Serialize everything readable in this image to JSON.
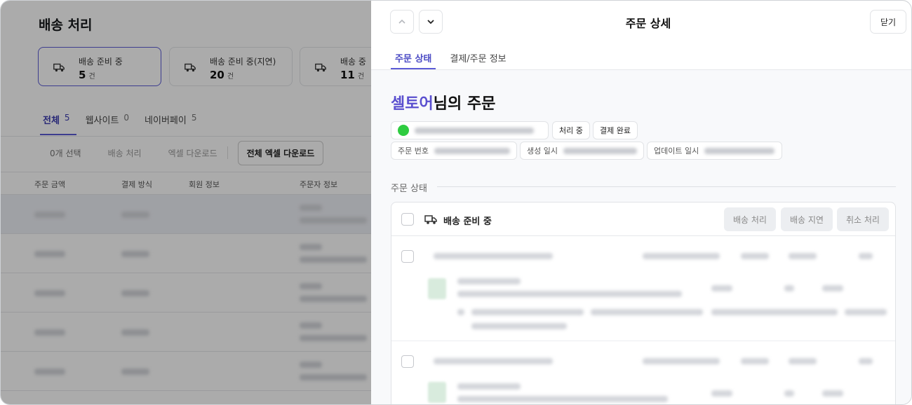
{
  "background": {
    "title": "배송 처리",
    "stats": [
      {
        "label": "배송 준비 중",
        "count": "5",
        "unit": "건"
      },
      {
        "label": "배송 준비 중(지연)",
        "count": "20",
        "unit": "건"
      },
      {
        "label": "배송 중",
        "count": "11",
        "unit": "건"
      }
    ],
    "tabs": [
      {
        "label": "전체",
        "count": "5"
      },
      {
        "label": "웹사이트",
        "count": "0"
      },
      {
        "label": "네이버페이",
        "count": "5"
      }
    ],
    "actions": {
      "selected": "0개 선택",
      "ship": "배송 처리",
      "excel": "엑셀 다운로드",
      "excel_all": "전체 엑셀 다운로드"
    },
    "columns": [
      "주문 금액",
      "결제 방식",
      "회원 정보",
      "주문자 정보"
    ]
  },
  "drawer": {
    "title": "주문 상세",
    "close_label": "닫기",
    "tabs": [
      "주문 상태",
      "결제/주문 정보"
    ],
    "customer_name": "셀토어",
    "order_suffix": "님의 주문",
    "status_chips": [
      "처리 중",
      "결제 완료"
    ],
    "meta": {
      "order_no_label": "주문 번호",
      "created_label": "생성 일시",
      "updated_label": "업데이트 일시"
    },
    "section_label": "주문 상태",
    "panel": {
      "title": "배송 준비 중",
      "buttons": [
        "배송 처리",
        "배송 지연",
        "취소 처리"
      ]
    }
  },
  "colors": {
    "accent": "#5b5bd6",
    "customer_name": "#5a4fcf",
    "status_green": "#2ecc40"
  },
  "icons": [
    "truck-icon",
    "chevron-up-icon",
    "chevron-down-icon",
    "checkbox-icon"
  ]
}
